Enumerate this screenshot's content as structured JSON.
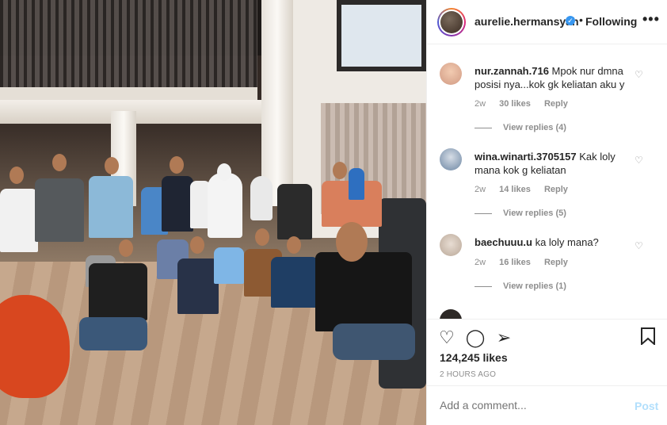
{
  "header": {
    "username": "aurelie.hermansyah",
    "separator": "•",
    "follow_status": "Following",
    "more_label": "•••"
  },
  "comments": [
    {
      "username": "nur.zannah.716",
      "text": "Mpok nur dmna posisi nya...kok gk keliatan aku y",
      "time": "2w",
      "likes": "30 likes",
      "reply_label": "Reply",
      "view_replies": "View replies (4)"
    },
    {
      "username": "wina.winarti.3705157",
      "text": "Kak loly mana kok g keliatan",
      "time": "2w",
      "likes": "14 likes",
      "reply_label": "Reply",
      "view_replies": "View replies (5)"
    },
    {
      "username": "baechuuu.u",
      "text": "ka loly mana?",
      "time": "2w",
      "likes": "16 likes",
      "reply_label": "Reply",
      "view_replies": "View replies (1)"
    }
  ],
  "actions": {
    "like_icon": "heart-icon",
    "comment_icon": "comment-icon",
    "share_icon": "paper-plane-icon",
    "save_icon": "bookmark-icon"
  },
  "post": {
    "likes": "124,245 likes",
    "time": "2 HOURS AGO"
  },
  "add_comment": {
    "placeholder": "Add a comment...",
    "post_label": "Post"
  },
  "colors": {
    "accent": "#3897f0",
    "post_disabled": "#b2dffc",
    "muted": "#8e8e8e"
  }
}
